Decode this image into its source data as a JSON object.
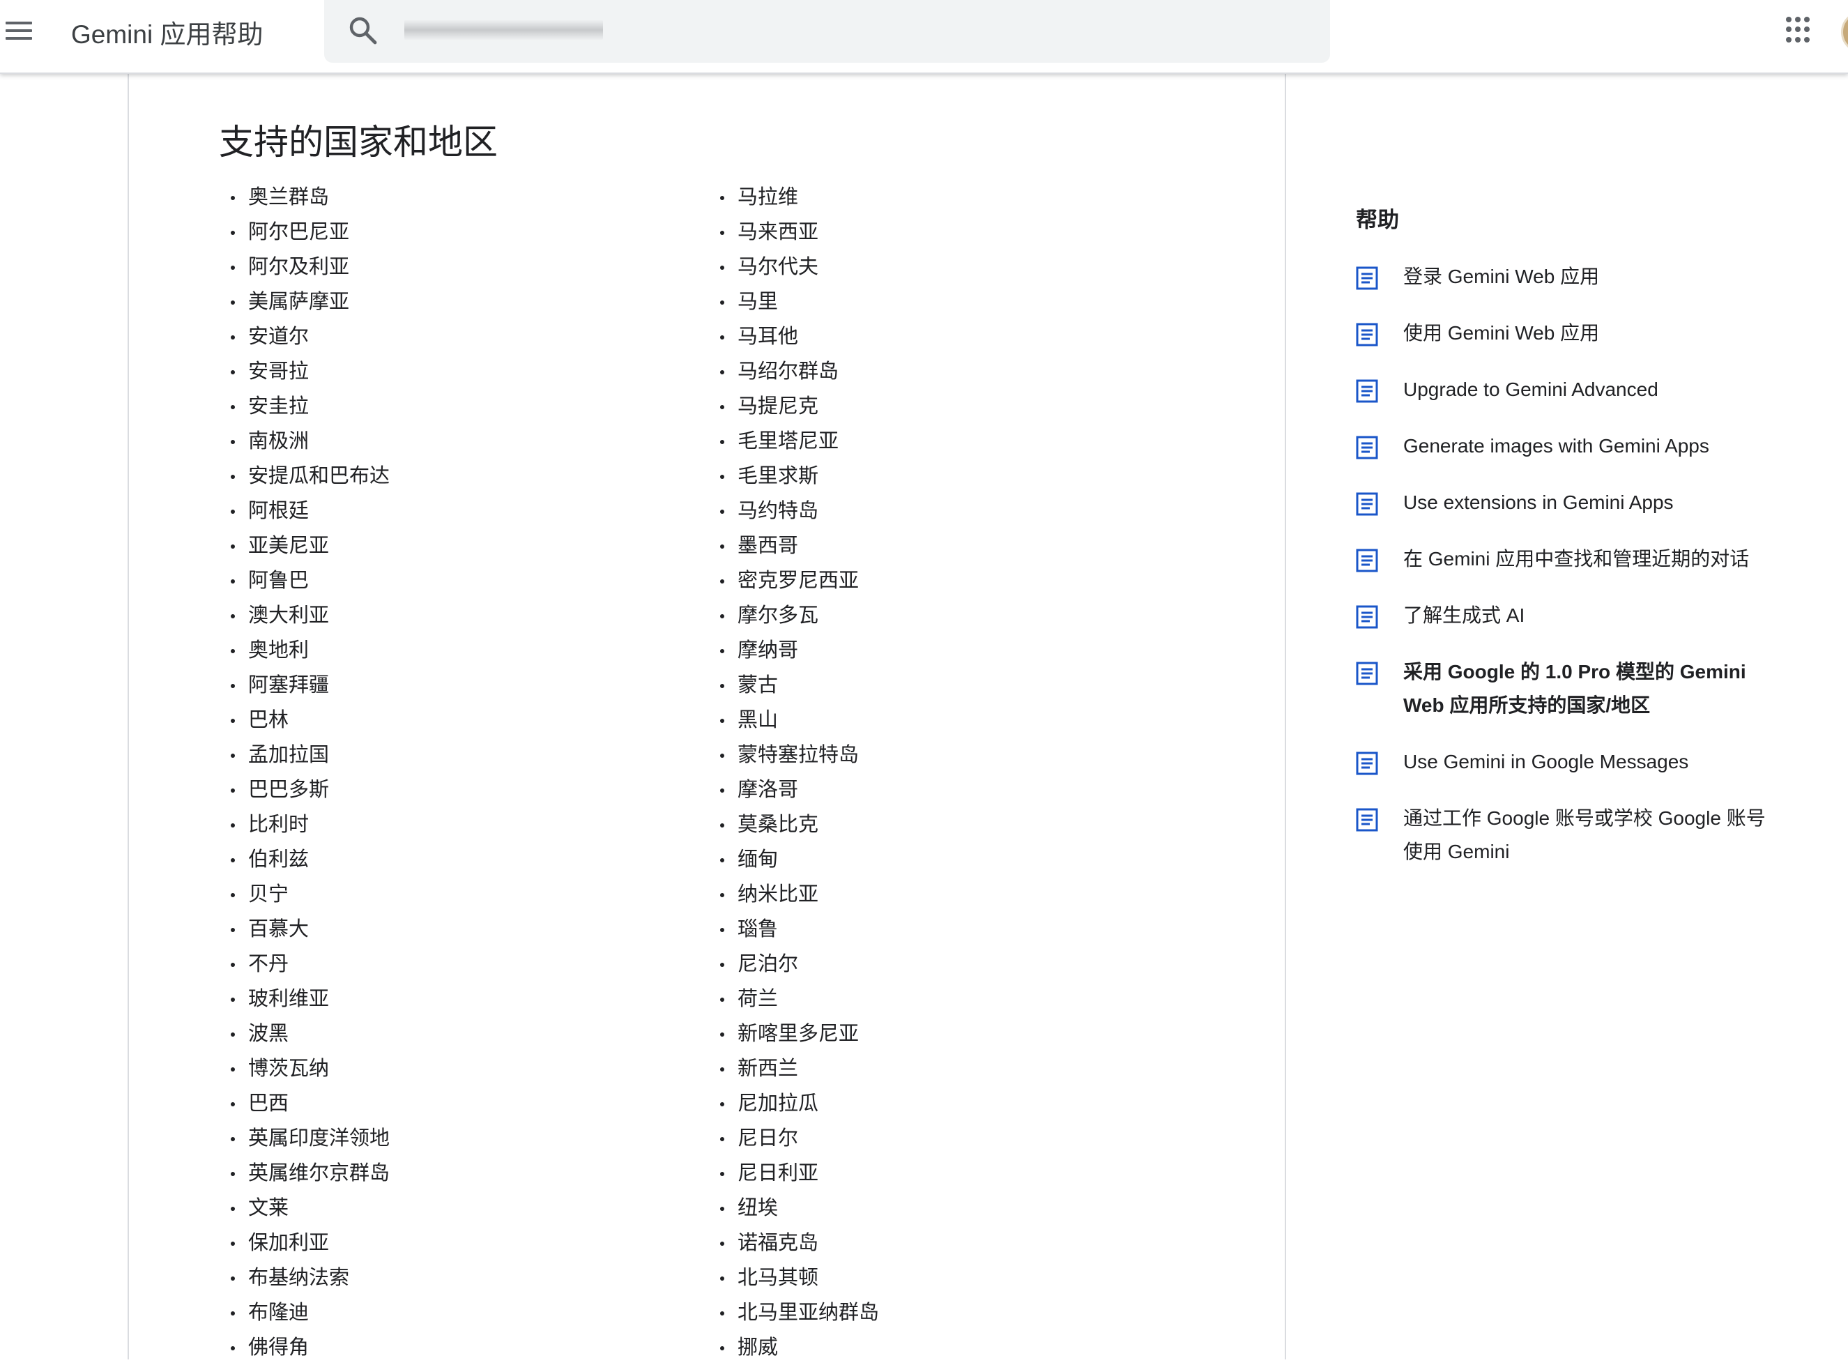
{
  "header": {
    "app_title": "Gemini 应用帮助",
    "search": {
      "value": "",
      "placeholder": ""
    }
  },
  "article": {
    "title": "支持的国家和地区",
    "left_column": [
      "奥兰群岛",
      "阿尔巴尼亚",
      "阿尔及利亚",
      "美属萨摩亚",
      "安道尔",
      "安哥拉",
      "安圭拉",
      "南极洲",
      "安提瓜和巴布达",
      "阿根廷",
      "亚美尼亚",
      "阿鲁巴",
      "澳大利亚",
      "奥地利",
      "阿塞拜疆",
      "巴林",
      "孟加拉国",
      "巴巴多斯",
      "比利时",
      "伯利兹",
      "贝宁",
      "百慕大",
      "不丹",
      "玻利维亚",
      "波黑",
      "博茨瓦纳",
      "巴西",
      "英属印度洋领地",
      "英属维尔京群岛",
      "文莱",
      "保加利亚",
      "布基纳法索",
      "布隆迪",
      "佛得角"
    ],
    "right_column": [
      "马拉维",
      "马来西亚",
      "马尔代夫",
      "马里",
      "马耳他",
      "马绍尔群岛",
      "马提尼克",
      "毛里塔尼亚",
      "毛里求斯",
      "马约特岛",
      "墨西哥",
      "密克罗尼西亚",
      "摩尔多瓦",
      "摩纳哥",
      "蒙古",
      "黑山",
      "蒙特塞拉特岛",
      "摩洛哥",
      "莫桑比克",
      "缅甸",
      "纳米比亚",
      "瑙鲁",
      "尼泊尔",
      "荷兰",
      "新喀里多尼亚",
      "新西兰",
      "尼加拉瓜",
      "尼日尔",
      "尼日利亚",
      "纽埃",
      "诺福克岛",
      "北马其顿",
      "北马里亚纳群岛",
      "挪威"
    ]
  },
  "sidebar": {
    "title": "帮助",
    "items": [
      {
        "label": "登录 Gemini Web 应用"
      },
      {
        "label": "使用 Gemini Web 应用"
      },
      {
        "label": "Upgrade to Gemini Advanced"
      },
      {
        "label": "Generate images with Gemini Apps"
      },
      {
        "label": "Use extensions in Gemini Apps"
      },
      {
        "label": "在 Gemini 应用中查找和管理近期的对话"
      },
      {
        "label": "了解生成式 AI"
      },
      {
        "label": "采用 Google 的 1.0 Pro 模型的 Gemini Web 应用所支持的国家/地区",
        "current": true
      },
      {
        "label": "Use Gemini in Google Messages"
      },
      {
        "label": "通过工作 Google 账号或学校 Google 账号使用 Gemini"
      }
    ]
  },
  "icons": {
    "menu": "menu-icon",
    "search": "search-icon",
    "apps": "apps-grid-icon",
    "article": "article-icon"
  },
  "colors": {
    "accent_icon": "#1a56c9",
    "text": "#202124",
    "header_icon": "#5f6368",
    "search_bg": "#f1f3f4"
  }
}
